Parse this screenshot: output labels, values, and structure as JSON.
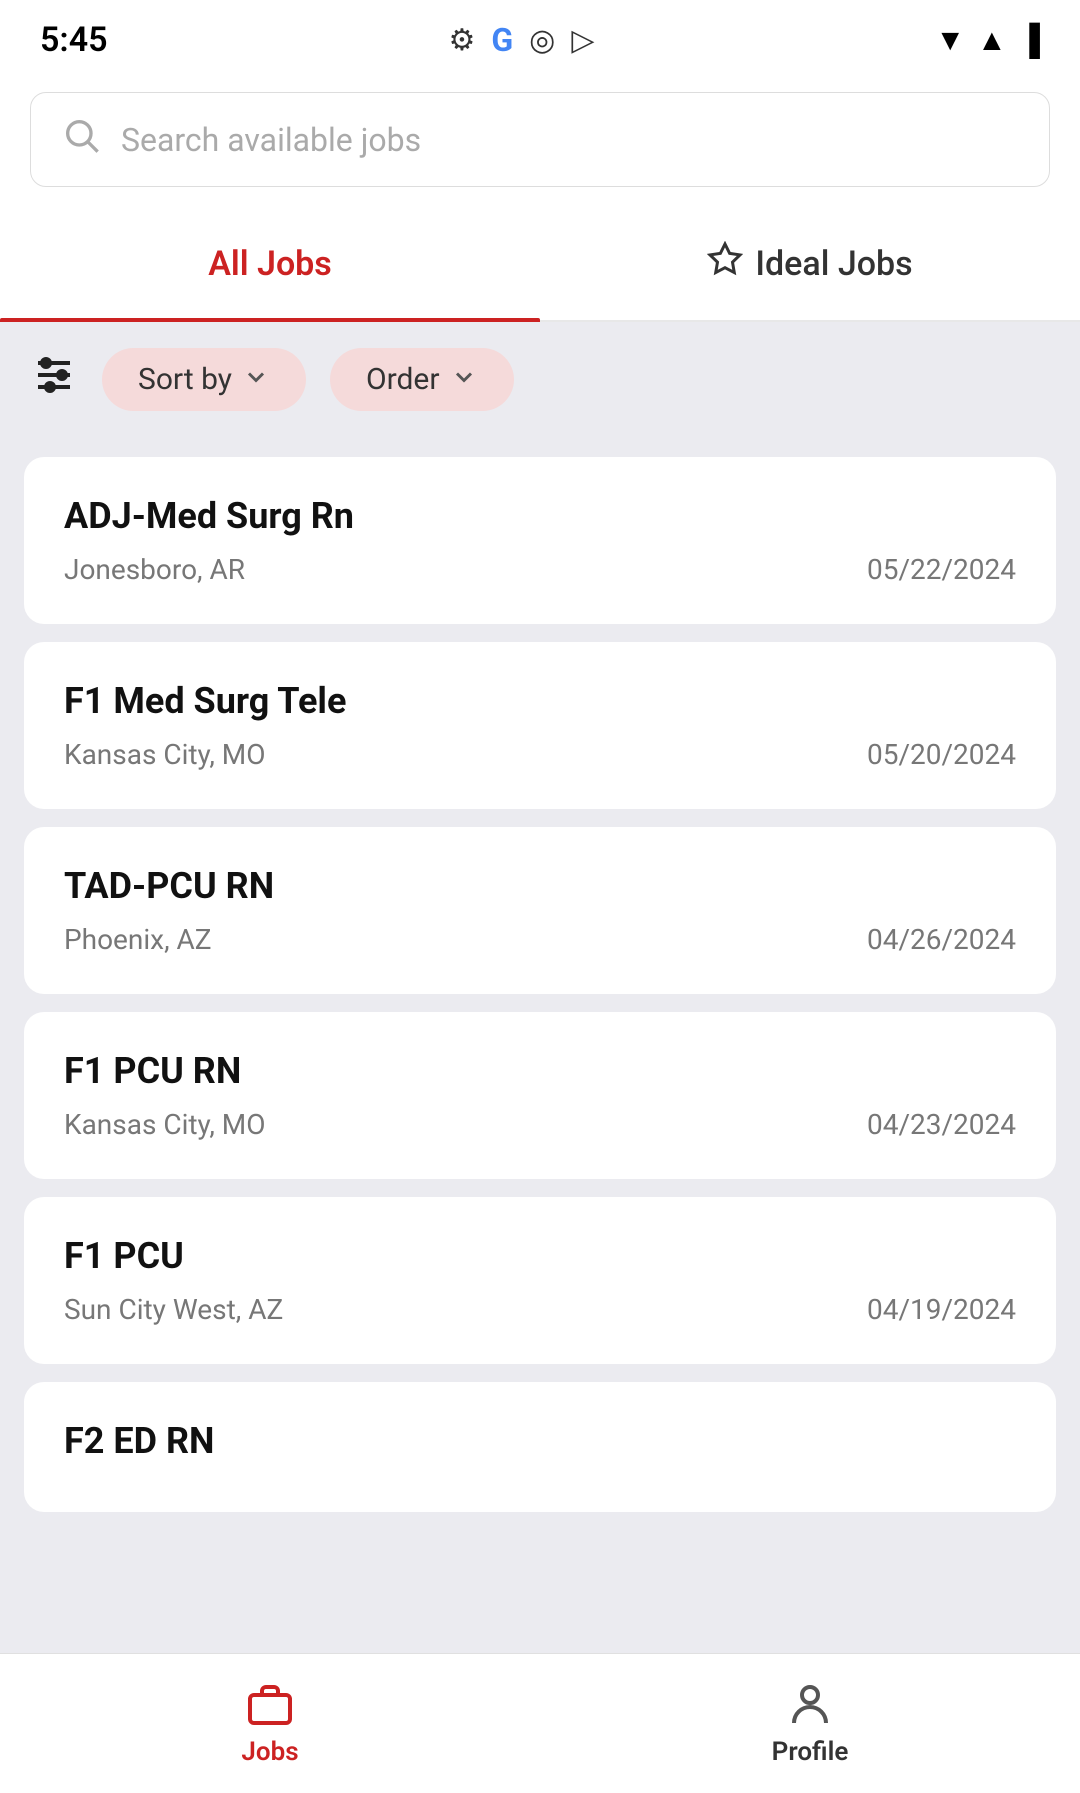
{
  "statusBar": {
    "time": "5:45",
    "icons": [
      "⚙",
      "G",
      "◎",
      "▷"
    ]
  },
  "search": {
    "placeholder": "Search available jobs"
  },
  "tabs": [
    {
      "id": "all-jobs",
      "label": "All Jobs",
      "active": true,
      "icon": null
    },
    {
      "id": "ideal-jobs",
      "label": "Ideal Jobs",
      "active": false,
      "icon": "☆"
    }
  ],
  "filters": {
    "sliders_label": "⊞",
    "sort_label": "Sort by",
    "order_label": "Order"
  },
  "jobs": [
    {
      "title": "ADJ-Med Surg Rn",
      "location": "Jonesboro, AR",
      "date": "05/22/2024"
    },
    {
      "title": "F1 Med Surg Tele",
      "location": "Kansas City, MO",
      "date": "05/20/2024"
    },
    {
      "title": "TAD-PCU RN",
      "location": "Phoenix, AZ",
      "date": "04/26/2024"
    },
    {
      "title": "F1 PCU RN",
      "location": "Kansas City, MO",
      "date": "04/23/2024"
    },
    {
      "title": "F1 PCU",
      "location": "Sun City West, AZ",
      "date": "04/19/2024"
    },
    {
      "title": "F2 ED RN",
      "location": "",
      "date": ""
    }
  ],
  "bottomNav": [
    {
      "id": "jobs",
      "label": "Jobs",
      "icon": "briefcase",
      "active": true
    },
    {
      "id": "profile",
      "label": "Profile",
      "icon": "person",
      "active": false
    }
  ]
}
